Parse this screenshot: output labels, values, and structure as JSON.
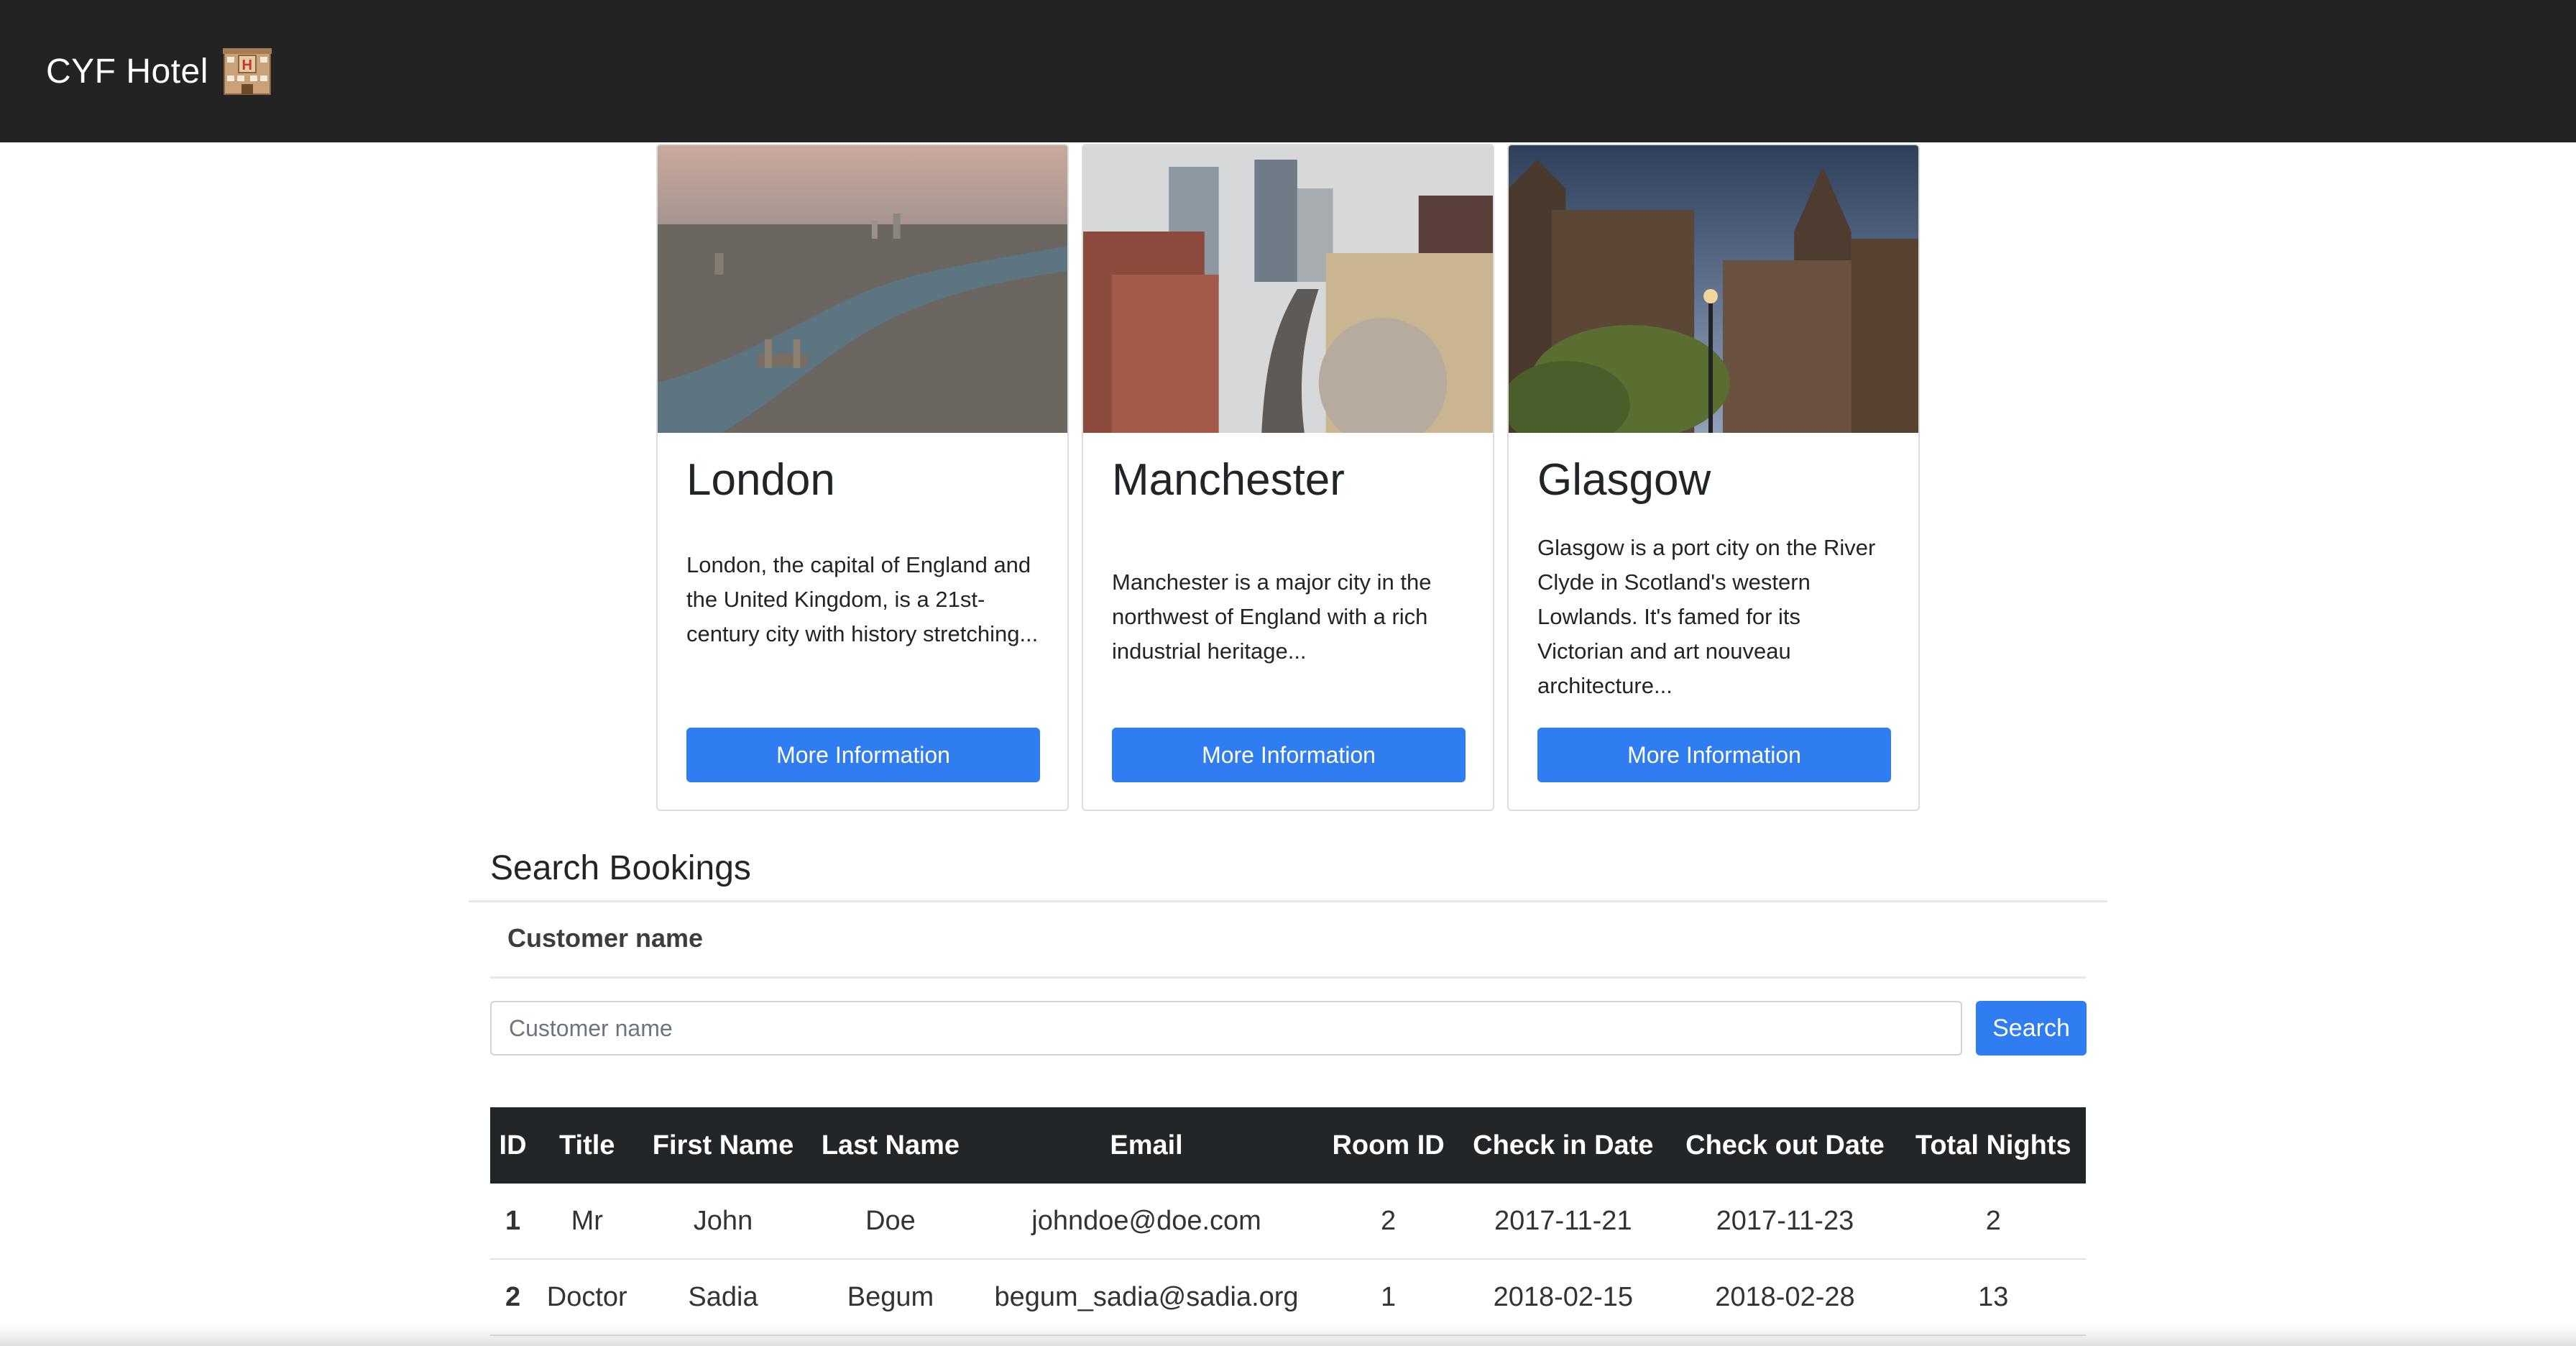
{
  "header": {
    "brand": "CYF Hotel",
    "brand_icon": "hotel-icon"
  },
  "cities": [
    {
      "name": "London",
      "description": "London, the capital of England and the United Kingdom, is a 21st-century city with history stretching...",
      "button": "More Information"
    },
    {
      "name": "Manchester",
      "description": "Manchester is a major city in the northwest of England with a rich industrial heritage...",
      "button": "More Information"
    },
    {
      "name": "Glasgow",
      "description": "Glasgow is a port city on the River Clyde in Scotland's western Lowlands. It's famed for its Victorian and art nouveau architecture...",
      "button": "More Information"
    }
  ],
  "search": {
    "title": "Search Bookings",
    "label": "Customer name",
    "placeholder": "Customer name",
    "button": "Search"
  },
  "table": {
    "headers": [
      "ID",
      "Title",
      "First Name",
      "Last Name",
      "Email",
      "Room ID",
      "Check in Date",
      "Check out Date",
      "Total Nights"
    ],
    "rows": [
      [
        "1",
        "Mr",
        "John",
        "Doe",
        "johndoe@doe.com",
        "2",
        "2017-11-21",
        "2017-11-23",
        "2"
      ],
      [
        "2",
        "Doctor",
        "Sadia",
        "Begum",
        "begum_sadia@sadia.org",
        "1",
        "2018-02-15",
        "2018-02-28",
        "13"
      ]
    ]
  },
  "colors": {
    "navbar": "#232323",
    "accent": "#2f7df0",
    "table_header": "#232629"
  }
}
